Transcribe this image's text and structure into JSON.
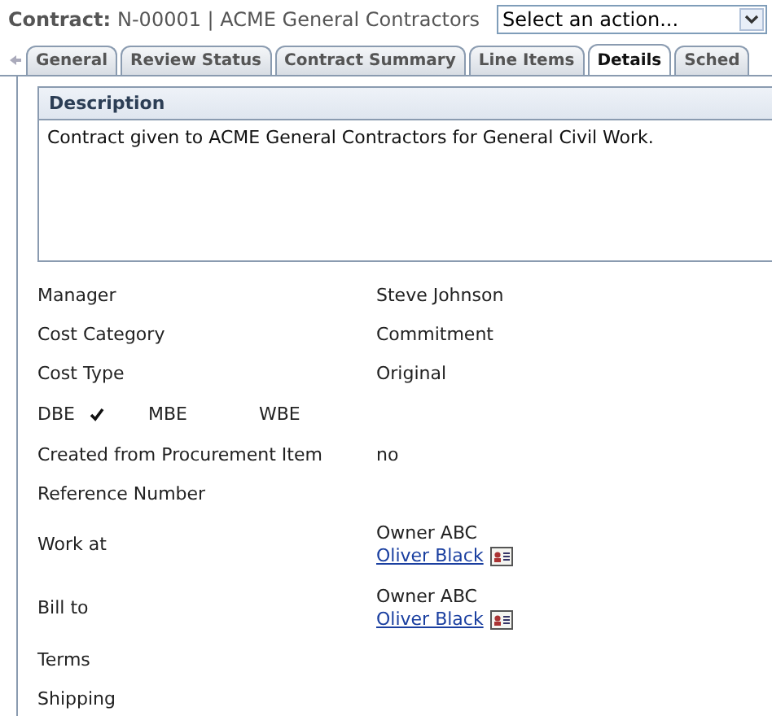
{
  "header": {
    "label": "Contract:",
    "title": "N-00001 | ACME General Contractors",
    "action_select": {
      "placeholder": "Select an action..."
    }
  },
  "tabs": [
    {
      "label": "General",
      "selected": false
    },
    {
      "label": "Review Status",
      "selected": false
    },
    {
      "label": "Contract Summary",
      "selected": false
    },
    {
      "label": "Line Items",
      "selected": false
    },
    {
      "label": "Details",
      "selected": true
    },
    {
      "label": "Sched",
      "selected": false
    }
  ],
  "description": {
    "heading": "Description",
    "text": "Contract given to ACME General Contractors for General Civil Work."
  },
  "fields": [
    {
      "kind": "text",
      "label": "Manager",
      "value": "Steve Johnson"
    },
    {
      "kind": "text",
      "label": "Cost Category",
      "value": "Commitment"
    },
    {
      "kind": "text",
      "label": "Cost Type",
      "value": "Original"
    },
    {
      "kind": "flags",
      "flags": [
        {
          "label": "DBE",
          "checked": true
        },
        {
          "label": "MBE",
          "checked": false
        },
        {
          "label": "WBE",
          "checked": false
        }
      ]
    },
    {
      "kind": "text",
      "label": "Created from Procurement Item",
      "value": "no"
    },
    {
      "kind": "text",
      "label": "Reference Number"
    },
    {
      "kind": "contact",
      "label": "Work at",
      "company": "Owner ABC",
      "person": "Oliver Black"
    },
    {
      "kind": "contact",
      "label": "Bill to",
      "company": "Owner ABC",
      "person": "Oliver Black"
    },
    {
      "kind": "text",
      "label": "Terms"
    },
    {
      "kind": "text",
      "label": "Shipping"
    }
  ]
}
